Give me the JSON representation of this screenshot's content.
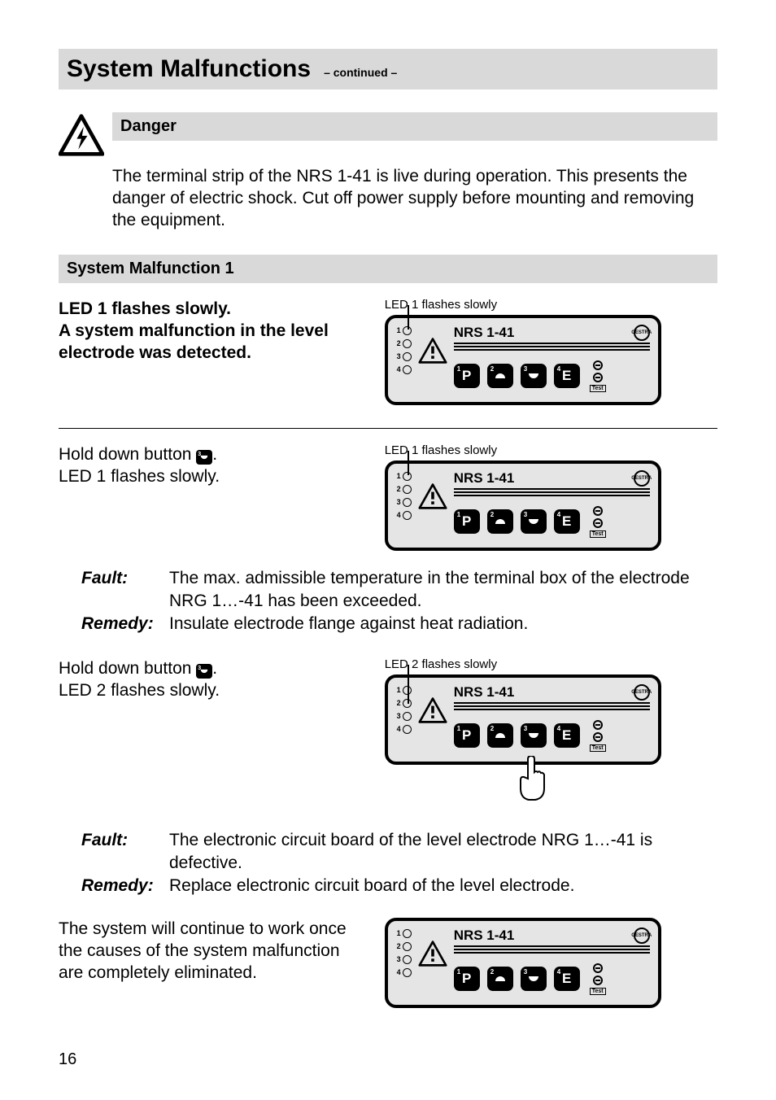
{
  "title": "System Malfunctions",
  "continued": "– continued –",
  "danger": {
    "heading": "Danger",
    "body": "The terminal strip of the NRS 1-41 is live during operation. This presents the danger of electric shock. Cut off power supply before mounting and removing the equipment."
  },
  "section1": {
    "heading": "System Malfunction 1",
    "lead_line1": "LED 1 flashes slowly.",
    "lead_line2": "A system malfunction in the level electrode was detected.",
    "panel_label": "LED 1 flashes slowly"
  },
  "step_a": {
    "instr_pre": "Hold down button ",
    "instr_post": ".",
    "instr_line2": "LED 1 flashes slowly.",
    "panel_label": "LED 1 flashes slowly"
  },
  "fault_a": {
    "fault": "The max. admissible temperature in the terminal box of the electrode NRG 1…-41 has been exceeded.",
    "remedy": "Insulate electrode flange against heat radiation."
  },
  "step_b": {
    "instr_pre": "Hold down button ",
    "instr_post": ".",
    "instr_line2": "LED 2 flashes slowly.",
    "panel_label": "LED 2 flashes slowly"
  },
  "fault_b": {
    "fault": "The electronic circuit board of the level electrode NRG 1…-41 is defective.",
    "remedy": "Replace electronic circuit board of the level electrode."
  },
  "closing": "The system will continue to work once the causes of the system malfunction are completely eliminated.",
  "panel": {
    "model": "NRS 1-41",
    "btn1": "P",
    "btn4": "E",
    "sup1": "1",
    "sup2": "2",
    "sup3": "3",
    "sup4": "4",
    "test": "Test",
    "led1": "1",
    "led2": "2",
    "led3": "3",
    "led4": "4",
    "brand": "GESTRA"
  },
  "labels": {
    "fault": "Fault:",
    "remedy": "Remedy:"
  },
  "page_number": "16"
}
